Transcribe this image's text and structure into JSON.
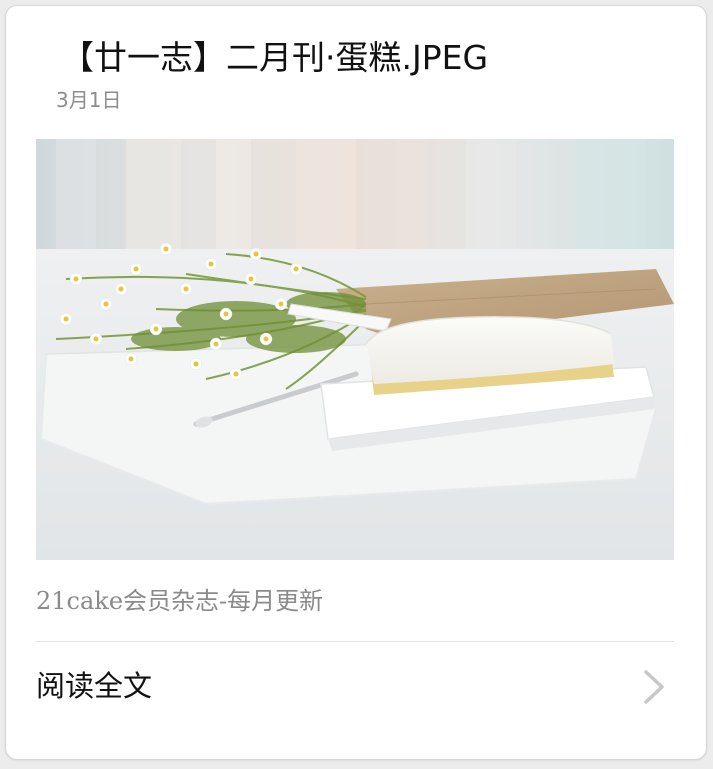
{
  "article": {
    "title": "【廿一志】二月刊·蛋糕.JPEG",
    "date": "3月1日",
    "cover_image": "cake-and-chamomile-photo",
    "digest": "21cake会员杂志-每月更新",
    "read_more_label": "阅读全文",
    "read_more_icon": "chevron-right-icon"
  },
  "colors": {
    "card_background": "#ffffff",
    "page_background": "#ececec",
    "title_text": "#111111",
    "secondary_text": "#8a8a8a",
    "divider": "#e3e3e3",
    "chevron": "#c7c7cc"
  }
}
